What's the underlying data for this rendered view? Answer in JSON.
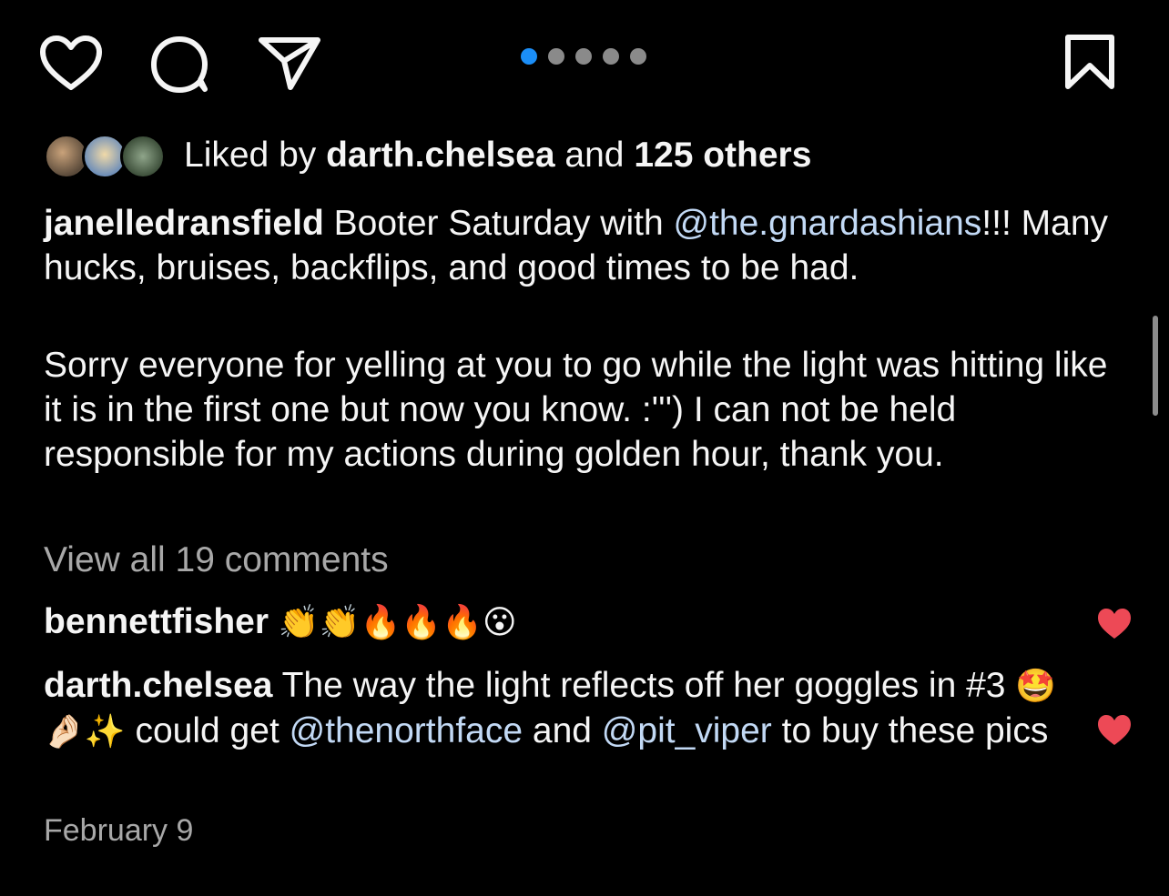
{
  "carousel": {
    "count": 5,
    "active_index": 0,
    "active_color": "#1b8ef7",
    "inactive_color": "#8a8a8a"
  },
  "actions": {
    "like_icon": "heart-outline-icon",
    "comment_icon": "comment-bubble-icon",
    "share_icon": "paper-plane-icon",
    "save_icon": "bookmark-icon"
  },
  "likes": {
    "prefix": "Liked by ",
    "user": "darth.chelsea",
    "middle": " and ",
    "others": "125 others"
  },
  "caption": {
    "username": "janelledransfield",
    "text_before_mention": " Booter Saturday with ",
    "mention": "@the.gnardashians",
    "text_after_mention": "!!! Many hucks, bruises, backflips, and good times to be had.",
    "paragraph2": "Sorry everyone for yelling at you to go while the light was hitting like it is in the first one but now you know. :''') I can not be held responsible for my actions during golden hour, thank you."
  },
  "view_comments_label": "View all 19 comments",
  "comments": [
    {
      "username": "bennettfisher",
      "emojis": "👏👏🔥🔥🔥😮",
      "liked": true
    },
    {
      "username": "darth.chelsea",
      "text1": " The way the light reflects off her goggles in #3 ",
      "emojis": "🤩🤌🏻✨",
      "text2": " could get ",
      "mention1": "@thenorthface",
      "text3": " and ",
      "mention2": "@pit_viper",
      "text4": " to buy these pics",
      "liked": true
    }
  ],
  "date": "February 9",
  "colors": {
    "background": "#000000",
    "text": "#f5f5f5",
    "secondary_text": "#a8a8a8",
    "mention": "#c2d9f5",
    "like_red": "#ed4956"
  }
}
